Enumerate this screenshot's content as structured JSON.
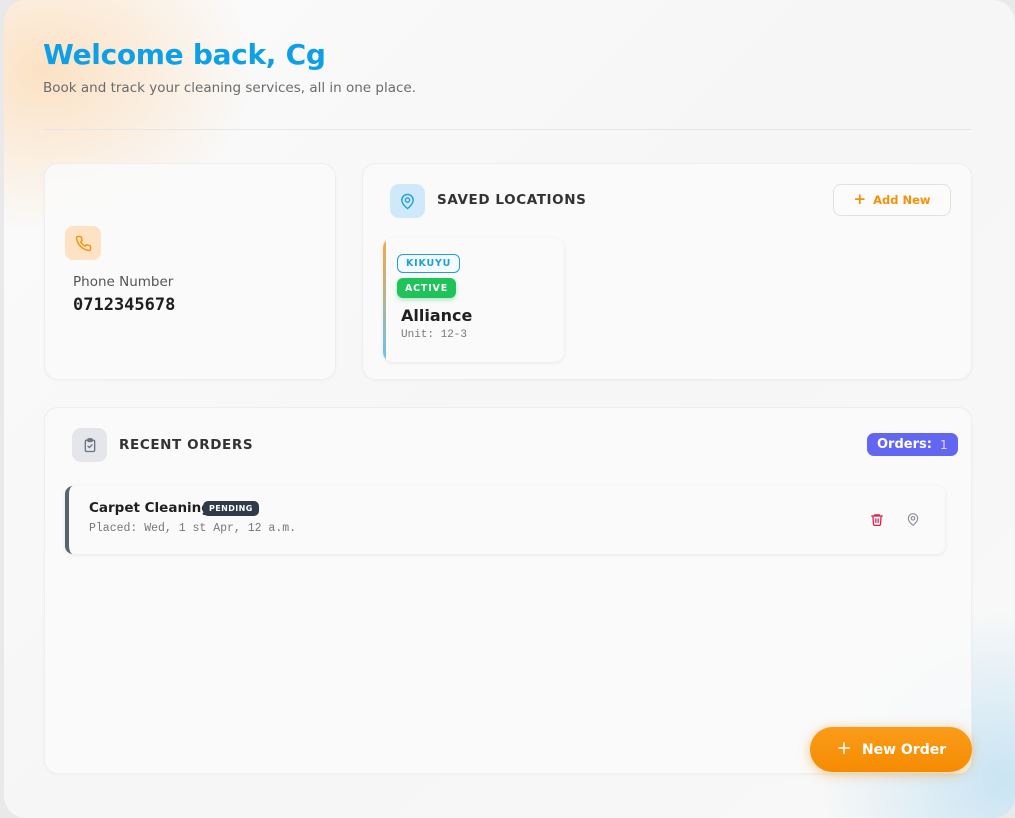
{
  "header": {
    "title": "Welcome back, Cg",
    "subtitle": "Book and track your cleaning services, all in one place."
  },
  "phone": {
    "icon": "phone-icon",
    "label": "Phone Number",
    "value": "0712345678"
  },
  "locations": {
    "icon": "map-pin-icon",
    "title": "SAVED LOCATIONS",
    "add_label": "Add New",
    "items": [
      {
        "area": "KIKUYU",
        "status": "ACTIVE",
        "name": "Alliance",
        "unit": "Unit: 12-3"
      }
    ]
  },
  "orders": {
    "icon": "clipboard-check-icon",
    "title": "RECENT ORDERS",
    "count_label": "Orders:",
    "count": "1",
    "items": [
      {
        "name": "Carpet Cleaning",
        "status": "PENDING",
        "placed": "Placed: Wed, 1 st Apr, 12 a.m."
      }
    ]
  },
  "new_order_label": "New Order",
  "colors": {
    "title": "#0ea0e6",
    "accent_orange": "#f58b02",
    "active_green": "#1ec35a",
    "orders_badge": "#6366f1",
    "delete_red": "#e11d48"
  }
}
